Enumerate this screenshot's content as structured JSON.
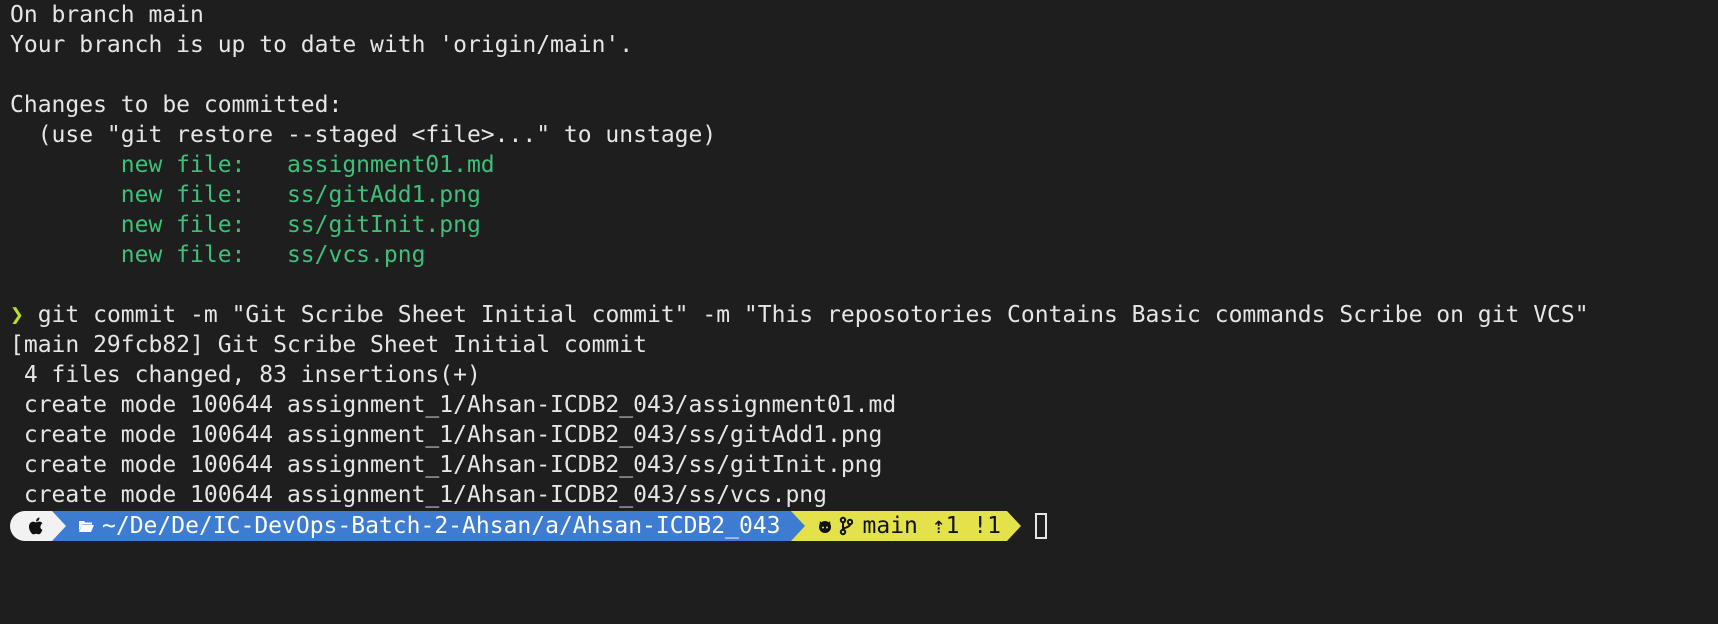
{
  "output": {
    "status_line1": "On branch main",
    "status_line2": "Your branch is up to date with 'origin/main'.",
    "status_blank1": "",
    "changes_header": "Changes to be committed:",
    "changes_hint": "  (use \"git restore --staged <file>...\" to unstage)",
    "staged_files": [
      "        new file:   assignment01.md",
      "        new file:   ss/gitAdd1.png",
      "        new file:   ss/gitInit.png",
      "        new file:   ss/vcs.png"
    ],
    "status_blank2": ""
  },
  "command": {
    "prompt_symbol": "❯",
    "text": " git commit -m \"Git Scribe Sheet Initial commit\" -m \"This reposotories Contains Basic commands Scribe on git VCS\""
  },
  "commit_output": [
    "[main 29fcb82] Git Scribe Sheet Initial commit",
    " 4 files changed, 83 insertions(+)",
    " create mode 100644 assignment_1/Ahsan-ICDB2_043/assignment01.md",
    " create mode 100644 assignment_1/Ahsan-ICDB2_043/ss/gitAdd1.png",
    " create mode 100644 assignment_1/Ahsan-ICDB2_043/ss/gitInit.png",
    " create mode 100644 assignment_1/Ahsan-ICDB2_043/ss/vcs.png"
  ],
  "prompt": {
    "apple_icon": "apple-icon",
    "path": "~/De/De/IC-DevOps-Batch-2-Ahsan/a/Ahsan-ICDB2_043",
    "git_branch": "main",
    "git_status": " ⇡1 !1"
  },
  "colors": {
    "background": "#1e1e1e",
    "text": "#e6e6e6",
    "staged_green": "#3ec07a",
    "prompt_arrow": "#b8e01f",
    "segment_dir": "#3e7cd1",
    "segment_git": "#e3e24b"
  }
}
